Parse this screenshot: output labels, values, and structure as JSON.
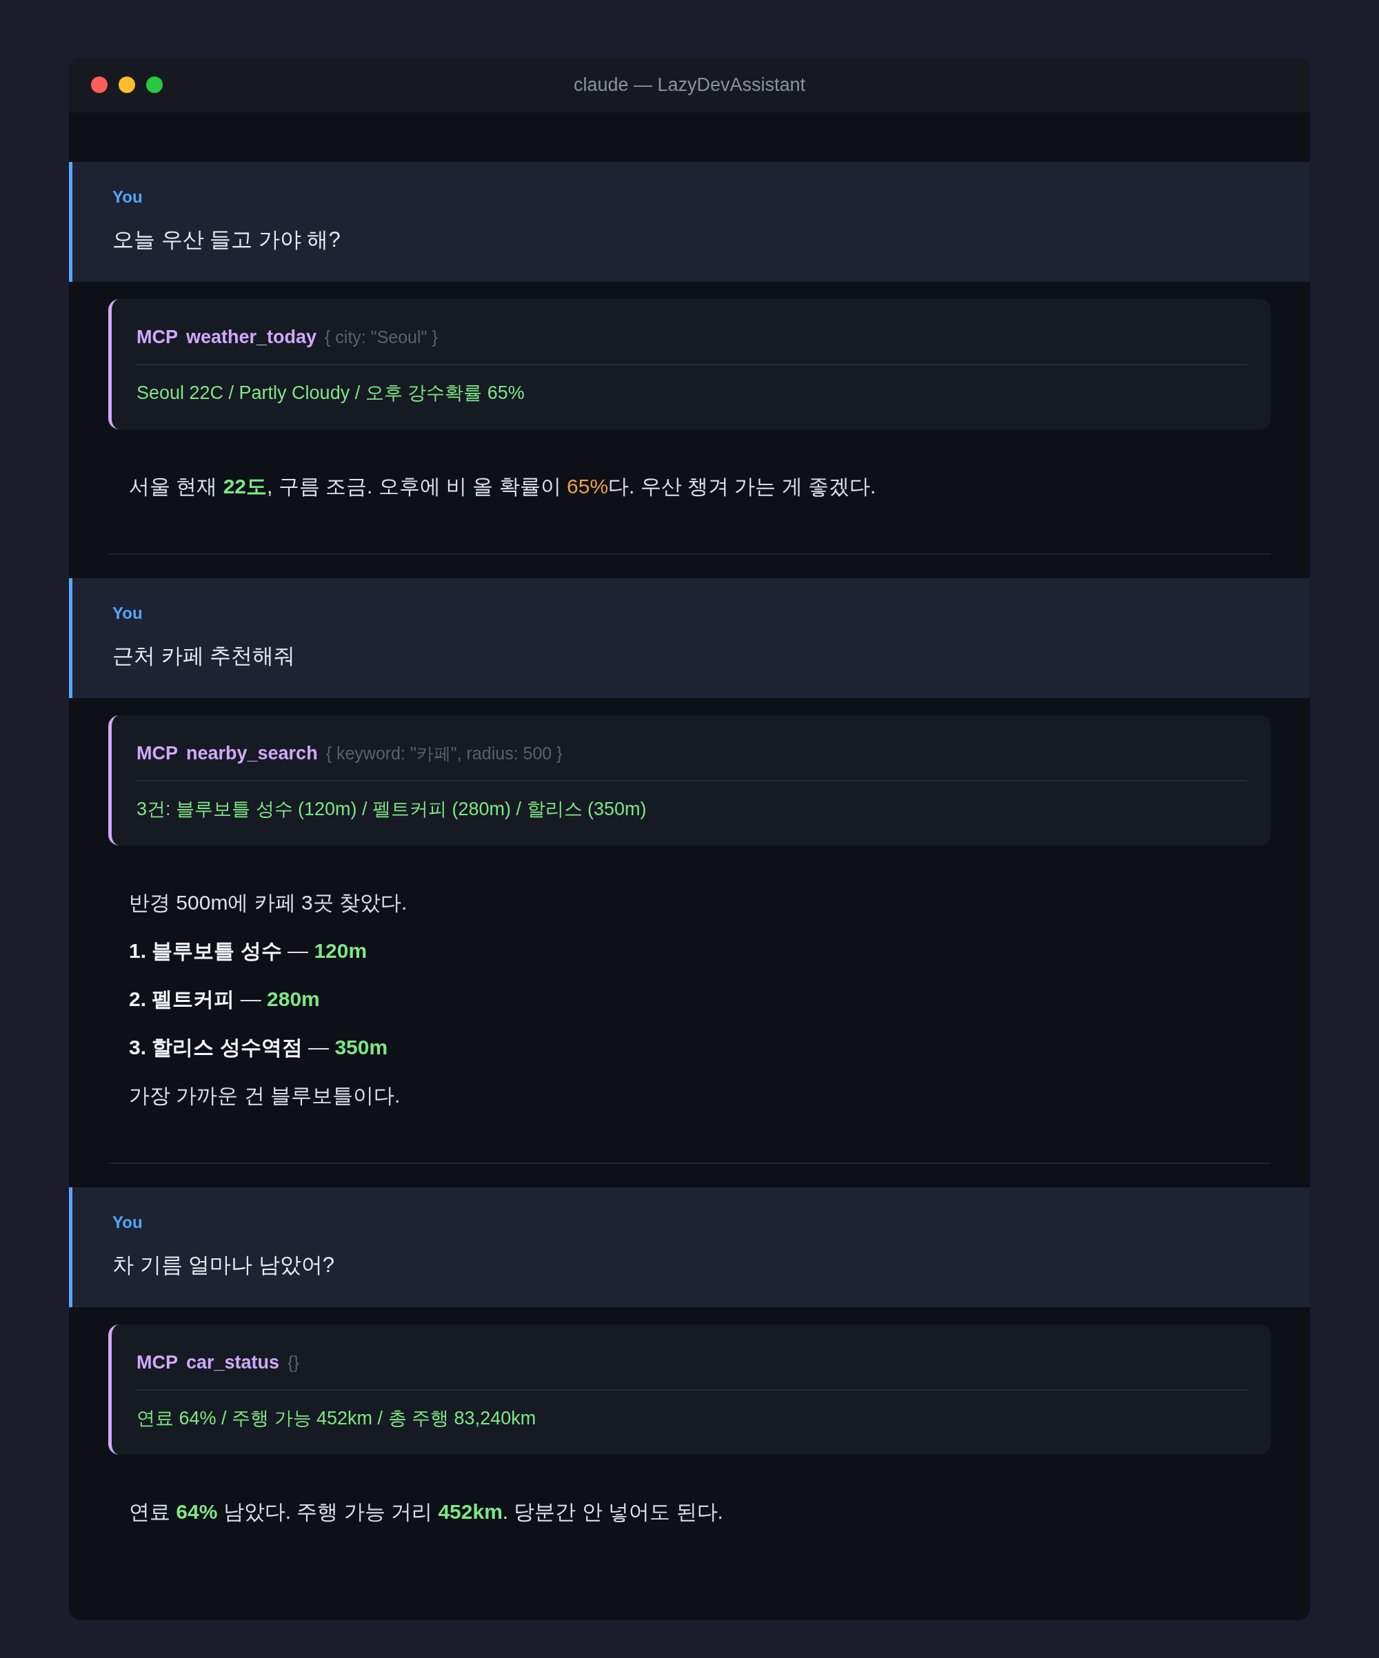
{
  "window": {
    "title": "claude — LazyDevAssistant"
  },
  "turns": [
    {
      "user": {
        "label": "You",
        "text": "오늘 우산 들고 가야 해?"
      },
      "tool": {
        "tag": "MCP",
        "name": "weather_today",
        "args": "{ city: \"Seoul\" }",
        "result": "Seoul 22C / Partly Cloudy / 오후 강수확률 65%"
      },
      "answer": [
        {
          "segments": [
            {
              "kind": "text",
              "text": "서울 현재 "
            },
            {
              "kind": "metric",
              "text": "22도"
            },
            {
              "kind": "text",
              "text": ", 구름 조금. 오후에 비 올 확률이 "
            },
            {
              "kind": "warn",
              "text": "65%"
            },
            {
              "kind": "text",
              "text": "다. 우산 챙겨 가는 게 좋겠다."
            }
          ]
        }
      ]
    },
    {
      "user": {
        "label": "You",
        "text": "근처 카페 추천해줘"
      },
      "tool": {
        "tag": "MCP",
        "name": "nearby_search",
        "args": "{ keyword: \"카페\", radius: 500 }",
        "result": "3건: 블루보틀 성수 (120m) / 펠트커피 (280m) / 할리스 (350m)"
      },
      "answer": [
        {
          "segments": [
            {
              "kind": "text",
              "text": "반경 500m에 카페 3곳 찾았다."
            }
          ]
        },
        {
          "segments": [
            {
              "kind": "strong",
              "text": "1. 블루보틀 성수"
            },
            {
              "kind": "text",
              "text": " — "
            },
            {
              "kind": "metric",
              "text": "120m"
            }
          ]
        },
        {
          "segments": [
            {
              "kind": "strong",
              "text": "2. 펠트커피"
            },
            {
              "kind": "text",
              "text": " — "
            },
            {
              "kind": "metric",
              "text": "280m"
            }
          ]
        },
        {
          "segments": [
            {
              "kind": "strong",
              "text": "3. 할리스 성수역점"
            },
            {
              "kind": "text",
              "text": " — "
            },
            {
              "kind": "metric",
              "text": "350m"
            }
          ]
        },
        {
          "segments": [
            {
              "kind": "text",
              "text": "가장 가까운 건 블루보틀이다."
            }
          ]
        }
      ]
    },
    {
      "user": {
        "label": "You",
        "text": "차 기름 얼마나 남았어?"
      },
      "tool": {
        "tag": "MCP",
        "name": "car_status",
        "args": "{}",
        "result": "연료 64% / 주행 가능 452km / 총 주행 83,240km"
      },
      "answer": [
        {
          "segments": [
            {
              "kind": "text",
              "text": "연료 "
            },
            {
              "kind": "metric",
              "text": "64%"
            },
            {
              "kind": "text",
              "text": " 남았다. 주행 가능 거리 "
            },
            {
              "kind": "metric",
              "text": "452km"
            },
            {
              "kind": "text",
              "text": ". 당분간 안 넣어도 된다."
            }
          ]
        }
      ]
    }
  ]
}
